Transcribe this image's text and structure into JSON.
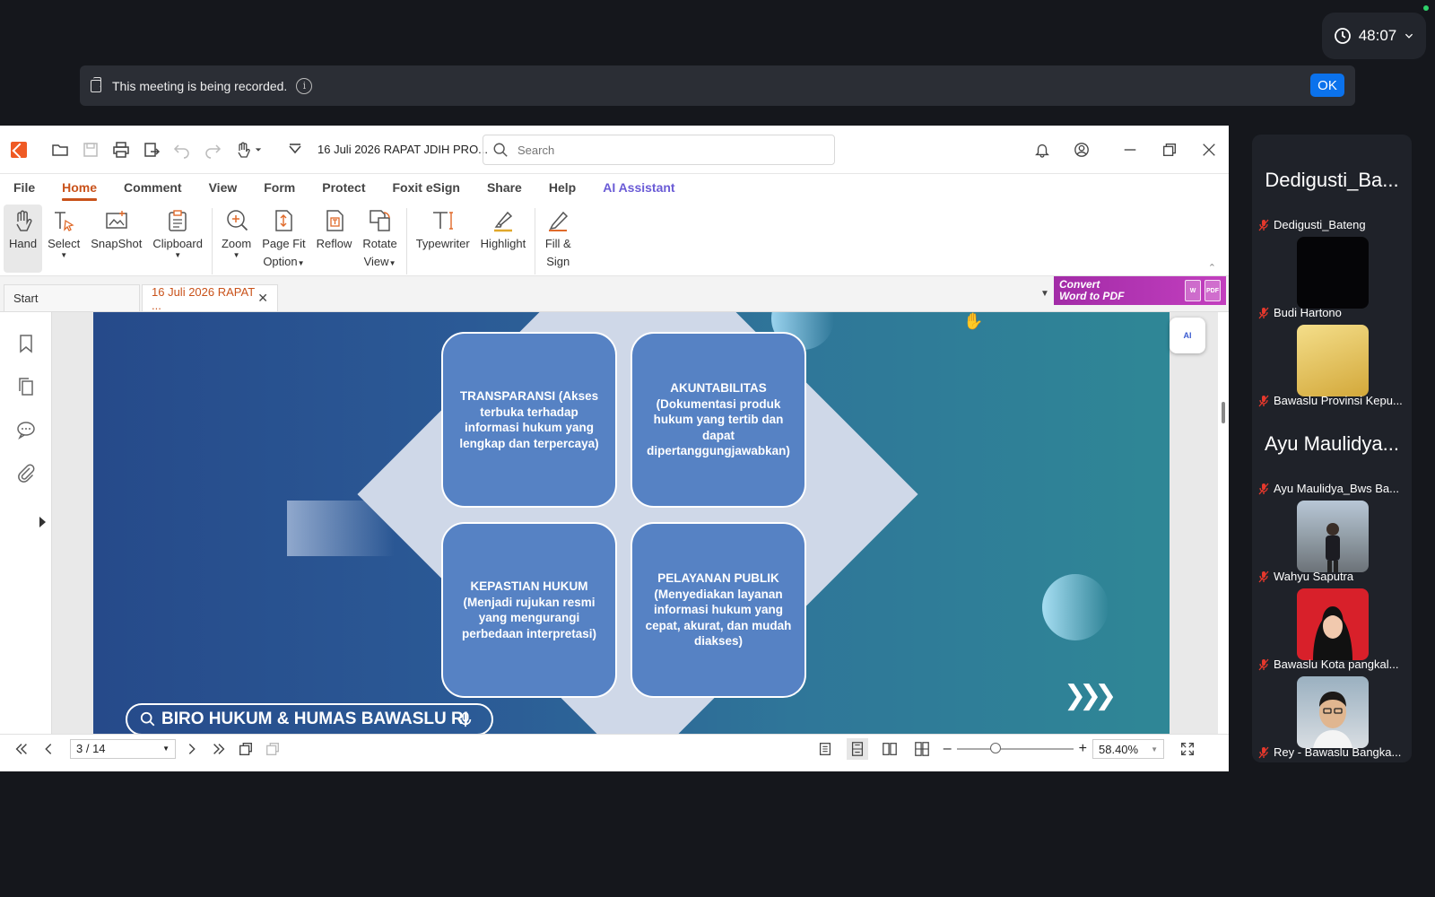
{
  "zoom": {
    "timer": "48:07"
  },
  "banner": {
    "text": "This meeting is being recorded.",
    "ok_label": "OK"
  },
  "foxit": {
    "doc_title": "16 Juli 2026 RAPAT JDIH PRO...",
    "search_placeholder": "Search",
    "menu": [
      "File",
      "Home",
      "Comment",
      "View",
      "Form",
      "Protect",
      "Foxit eSign",
      "Share",
      "Help",
      "AI Assistant"
    ],
    "ribbon": {
      "hand": "Hand",
      "select": "Select",
      "snapshot": "SnapShot",
      "clipboard": "Clipboard",
      "zoom": "Zoom",
      "page_fit_1": "Page Fit",
      "page_fit_2": "Option",
      "reflow": "Reflow",
      "rotate_1": "Rotate",
      "rotate_2": "View",
      "typewriter": "Typewriter",
      "highlight": "Highlight",
      "fill_1": "Fill &",
      "fill_2": "Sign"
    },
    "tabs": {
      "start": "Start",
      "active": "16 Juli 2026 RAPAT ..."
    },
    "promo": {
      "line1": "Convert",
      "line2": "Word to PDF",
      "pdf": "PDF",
      "w": "W"
    },
    "helper_label": "AI",
    "status": {
      "page": "3 / 14",
      "zoom_value": "58.40%",
      "zoom_level": 0.3
    }
  },
  "slide": {
    "cards": [
      "TRANSPARANSI (Akses terbuka terhadap informasi hukum yang lengkap dan terpercaya)",
      "AKUNTABILITAS (Dokumentasi produk hukum yang tertib dan dapat dipertanggungjawabkan)",
      "KEPASTIAN HUKUM (Menjadi rujukan resmi yang mengurangi perbedaan interpretasi)",
      "PELAYANAN PUBLIK (Menyediakan layanan informasi hukum yang cepat, akurat, dan mudah diakses)"
    ],
    "footer": "BIRO HUKUM & HUMAS BAWASLU RI"
  },
  "participants": [
    {
      "big": "Dedigusti_Ba...",
      "name": "Dedigusti_Bateng"
    },
    {
      "big": "",
      "name": "Budi Hartono"
    },
    {
      "big": "",
      "name": "Bawaslu Provinsi Kepu..."
    },
    {
      "big": "Ayu Maulidya...",
      "name": "Ayu Maulidya_Bws Ba..."
    },
    {
      "big": "",
      "name": "Wahyu Saputra"
    },
    {
      "big": "",
      "name": "Bawaslu Kota pangkal..."
    },
    {
      "big": "",
      "name": "Rey - Bawaslu Bangka..."
    }
  ],
  "colors": {
    "accent": "#c9521a",
    "zoom_blue": "#0b72ec",
    "muted_red": "#e5382c"
  }
}
